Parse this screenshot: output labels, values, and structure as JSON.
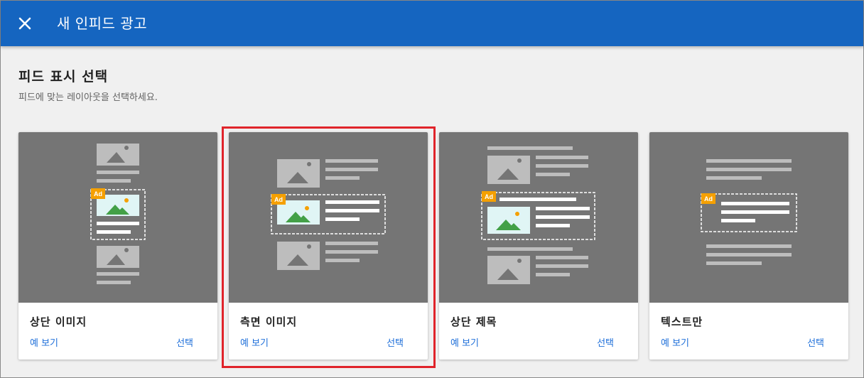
{
  "header": {
    "close_icon": "close-icon",
    "title": "새 인피드 광고"
  },
  "main": {
    "title": "피드 표시 선택",
    "subtitle": "피드에 맞는 레이아웃을 선택하세요.",
    "cards": [
      {
        "title": "상단 이미지",
        "preview_label": "예 보기",
        "select_label": "선택",
        "ad_badge": "Ad",
        "selected": false
      },
      {
        "title": "측면 이미지",
        "preview_label": "예 보기",
        "select_label": "선택",
        "ad_badge": "Ad",
        "selected": true
      },
      {
        "title": "상단 제목",
        "preview_label": "예 보기",
        "select_label": "선택",
        "ad_badge": "Ad",
        "selected": false
      },
      {
        "title": "텍스트만",
        "preview_label": "예 보기",
        "select_label": "선택",
        "ad_badge": "Ad",
        "selected": false
      }
    ]
  },
  "colors": {
    "appbar": "#1565c0",
    "link": "#1e6fd9",
    "ad_badge": "#f5a000",
    "highlight": "#e0242b",
    "preview_bg": "#757575"
  }
}
